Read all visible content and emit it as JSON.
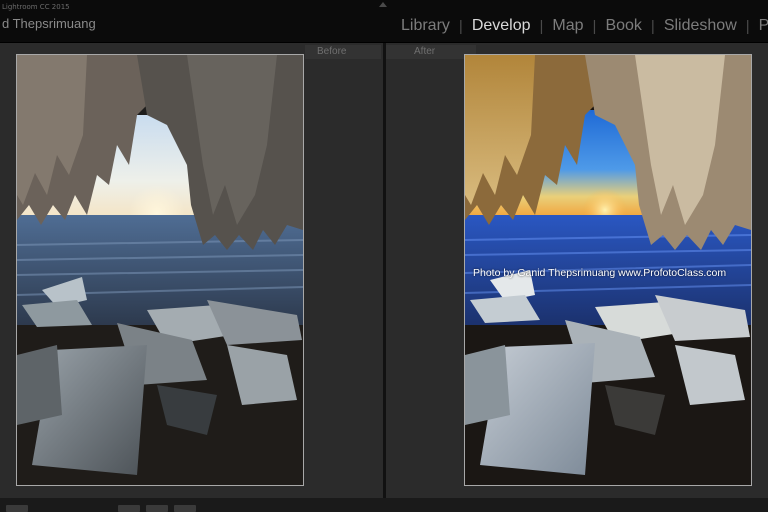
{
  "app": {
    "name": "Lightroom CC 2015",
    "user": "d Thepsrimuang"
  },
  "modules": [
    {
      "label": "Library",
      "active": false
    },
    {
      "label": "Develop",
      "active": true
    },
    {
      "label": "Map",
      "active": false
    },
    {
      "label": "Book",
      "active": false
    },
    {
      "label": "Slideshow",
      "active": false
    },
    {
      "label": "Pri",
      "active": false
    }
  ],
  "panels": {
    "before_label": "Before",
    "after_label": "After"
  },
  "watermark": "Photo by Ganid Thepsrimuang  www.ProfotoClass.com",
  "colors": {
    "background": "#262626",
    "active_module": "#d9d9d9",
    "inactive_module": "#7c7c7c"
  }
}
